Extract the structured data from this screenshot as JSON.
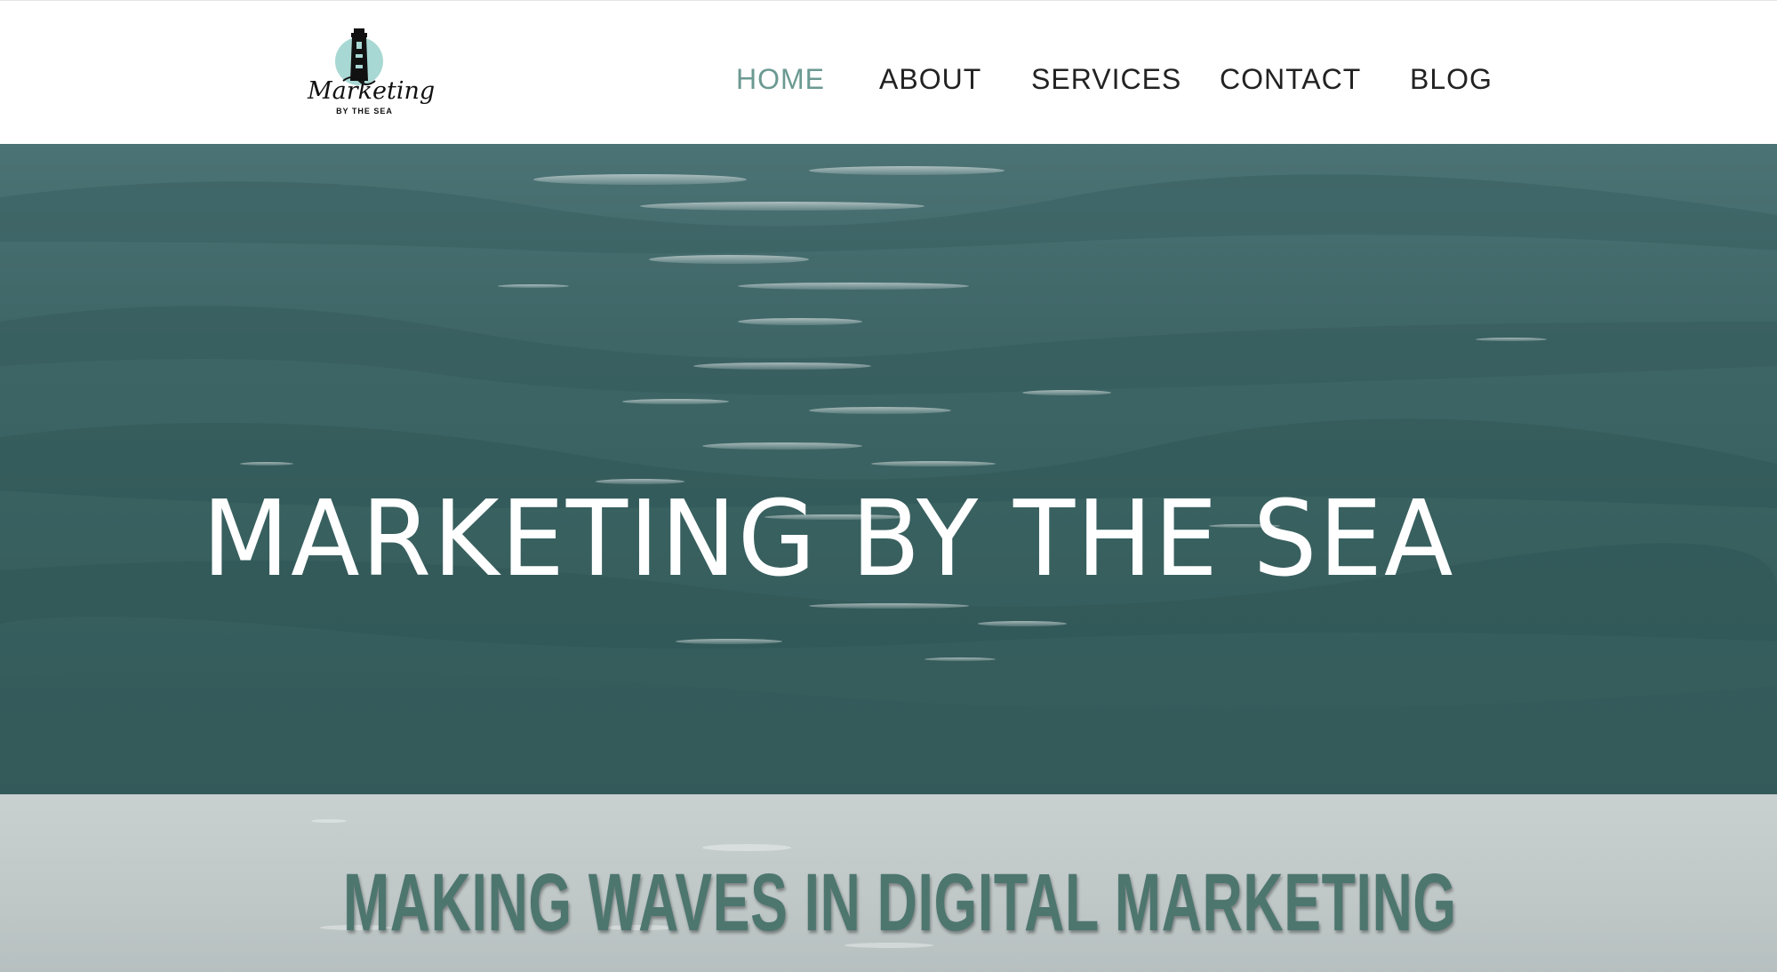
{
  "header": {
    "logo": {
      "name": "Marketing",
      "tagline": "BY THE SEA",
      "icon": "lighthouse-icon",
      "circle_color": "#a8d8d4"
    },
    "nav": [
      {
        "label": "HOME",
        "active": true
      },
      {
        "label": "ABOUT",
        "active": false
      },
      {
        "label": "SERVICES",
        "active": false
      },
      {
        "label": "CONTACT",
        "active": false
      },
      {
        "label": "BLOG",
        "active": false
      }
    ],
    "active_color": "#6b9a92"
  },
  "hero": {
    "title": "MARKETING BY THE SEA",
    "background": "ocean-waves-image"
  },
  "banner": {
    "title": "MAKING WAVES IN DIGITAL MARKETING",
    "text_color": "#4d766f"
  }
}
